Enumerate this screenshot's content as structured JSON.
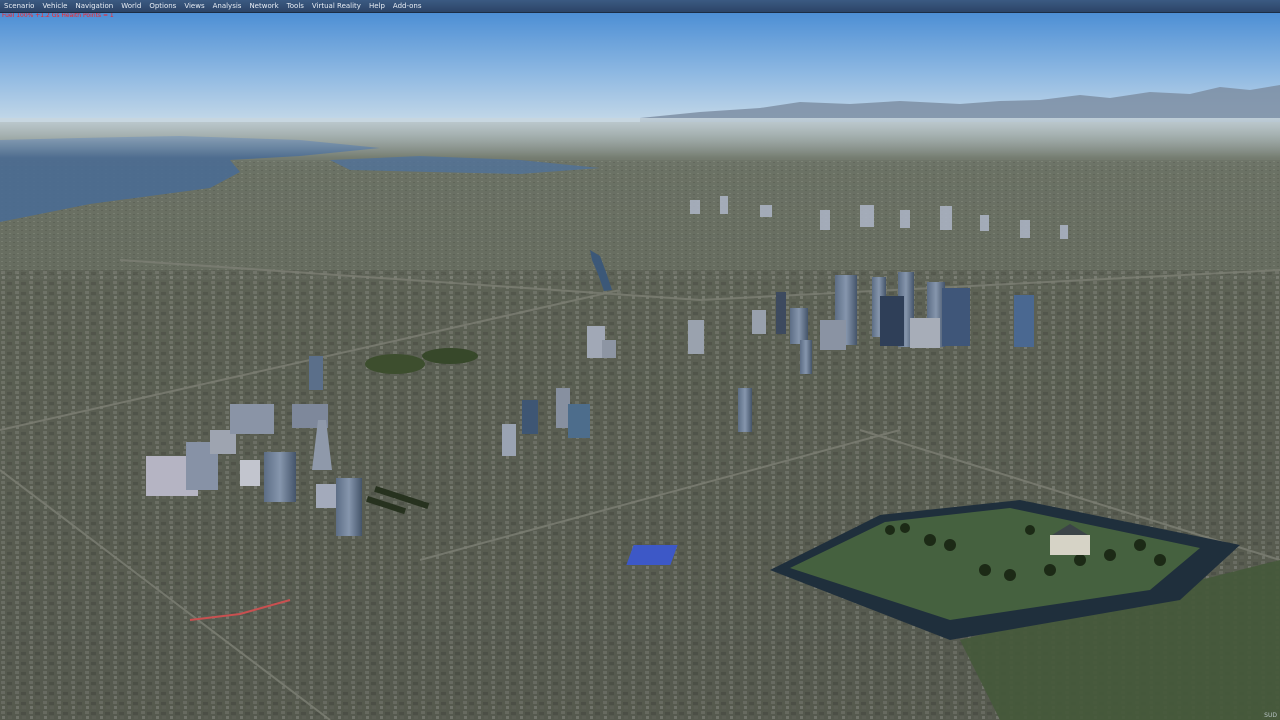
{
  "menubar": {
    "items": [
      {
        "label": "Scenario"
      },
      {
        "label": "Vehicle"
      },
      {
        "label": "Navigation"
      },
      {
        "label": "World"
      },
      {
        "label": "Options"
      },
      {
        "label": "Views"
      },
      {
        "label": "Analysis"
      },
      {
        "label": "Network"
      },
      {
        "label": "Tools"
      },
      {
        "label": "Virtual Reality"
      },
      {
        "label": "Help"
      },
      {
        "label": "Add-ons"
      }
    ]
  },
  "status": {
    "readout": "Fuel 100%   +1.2 Gs  Health Points = 1"
  },
  "footer": {
    "version": "SUD"
  },
  "colors": {
    "menubar": "#2c4467",
    "menu_text": "#e8eef6",
    "status_text": "#ff2020",
    "sky_top": "#4a8fd6",
    "sky_horizon": "#c5d9ea",
    "city_ground": "#5e6352",
    "water": "#3f5f84"
  }
}
